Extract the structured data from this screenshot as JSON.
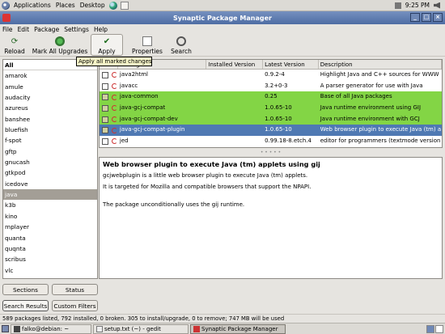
{
  "top_panel": {
    "menus": [
      "Applications",
      "Places",
      "Desktop"
    ],
    "clock": "9:25 PM"
  },
  "window": {
    "title": "Synaptic Package Manager",
    "controls": [
      "_",
      "□",
      "×"
    ]
  },
  "menubar": [
    "File",
    "Edit",
    "Package",
    "Settings",
    "Help"
  ],
  "toolbar": {
    "reload": "Reload",
    "mark_all": "Mark All Upgrades",
    "apply": "Apply",
    "properties": "Properties",
    "search": "Search",
    "tooltip": "Apply all marked changes"
  },
  "sidebar": {
    "items": [
      "All",
      "amarok",
      "amule",
      "audacity",
      "azureus",
      "banshee",
      "bluefish",
      "f-spot",
      "gftp",
      "gnucash",
      "gtkpod",
      "icedove",
      "java",
      "k3b",
      "kino",
      "mplayer",
      "quanta",
      "quqnta",
      "scribus",
      "vlc"
    ],
    "selected": "java",
    "buttons": {
      "sections": "Sections",
      "status": "Status",
      "search_results": "Search Results",
      "custom_filters": "Custom Filters"
    }
  },
  "table": {
    "columns": {
      "s": "S",
      "package": "Package",
      "installed": "Installed Version",
      "latest": "Latest Version",
      "description": "Description"
    },
    "rows": [
      {
        "package": "java2html",
        "installed": "",
        "latest": "0.9.2-4",
        "description": "Highlight Java and C++ sources for WWW",
        "state": "normal",
        "checked": false
      },
      {
        "package": "javacc",
        "installed": "",
        "latest": "3.2+0-3",
        "description": "A parser generator for use with Java",
        "state": "normal",
        "checked": false
      },
      {
        "package": "java-common",
        "installed": "",
        "latest": "0.25",
        "description": "Base of all Java packages",
        "state": "green",
        "checked": true
      },
      {
        "package": "java-gcj-compat",
        "installed": "",
        "latest": "1.0.65-10",
        "description": "Java runtime environment using GIJ",
        "state": "green",
        "checked": true
      },
      {
        "package": "java-gcj-compat-dev",
        "installed": "",
        "latest": "1.0.65-10",
        "description": "Java runtime environment with GCJ",
        "state": "green",
        "checked": true
      },
      {
        "package": "java-gcj-compat-plugin",
        "installed": "",
        "latest": "1.0.65-10",
        "description": "Web browser plugin to execute Java (tm) a",
        "state": "selected",
        "checked": true
      },
      {
        "package": "jed",
        "installed": "",
        "latest": "0.99.18-8.etch.4",
        "description": "editor for programmers (textmode version",
        "state": "normal",
        "checked": false
      }
    ]
  },
  "details": {
    "heading": "Web browser plugin to execute Java (tm) applets using gij",
    "lines": [
      "gcjwebplugin is a little web browser plugin to execute Java (tm) applets.",
      "It is targeted for Mozilla and compatible browsers that support the NPAPI.",
      "The package unconditionally uses the gij runtime."
    ]
  },
  "status": "589 packages listed, 792 installed, 0 broken. 305 to install/upgrade, 0 to remove; 747 MB will be used",
  "taskbar": {
    "items": [
      "falko@debian: ~",
      "setup.txt (~) - gedit",
      "Synaptic Package Manager"
    ]
  }
}
